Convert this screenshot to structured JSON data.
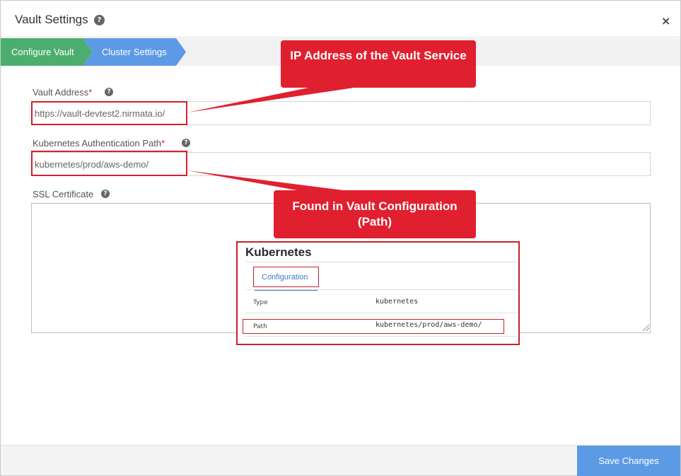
{
  "modal": {
    "title": "Vault Settings",
    "help_icon": "question-circle-icon",
    "close_label": "×"
  },
  "wizard": {
    "steps": [
      {
        "label": "Configure Vault",
        "state": "completed",
        "color": "#4cae6e"
      },
      {
        "label": "Cluster Settings",
        "state": "active",
        "color": "#5d9ae6"
      }
    ]
  },
  "form": {
    "vault_address": {
      "label": "Vault Address",
      "required_mark": "*",
      "value": "https://vault-devtest2.nirmata.io/"
    },
    "k8s_auth_path": {
      "label": "Kubernetes Authentication Path",
      "required_mark": "*",
      "value": "kubernetes/prod/aws-demo/"
    },
    "ssl_certificate": {
      "label": "SSL Certificate",
      "value": ""
    }
  },
  "annotations": {
    "callout_1": "IP Address of the Vault Service",
    "callout_2": "Found in Vault Configuration (Path)",
    "callout_color": "#e0202f"
  },
  "inset": {
    "title": "Kubernetes",
    "tab_label": "Configuration",
    "rows": [
      {
        "key": "Type",
        "value": "kubernetes"
      },
      {
        "key": "Path",
        "value": "kubernetes/prod/aws-demo/"
      }
    ]
  },
  "footer": {
    "save_label": "Save Changes"
  }
}
